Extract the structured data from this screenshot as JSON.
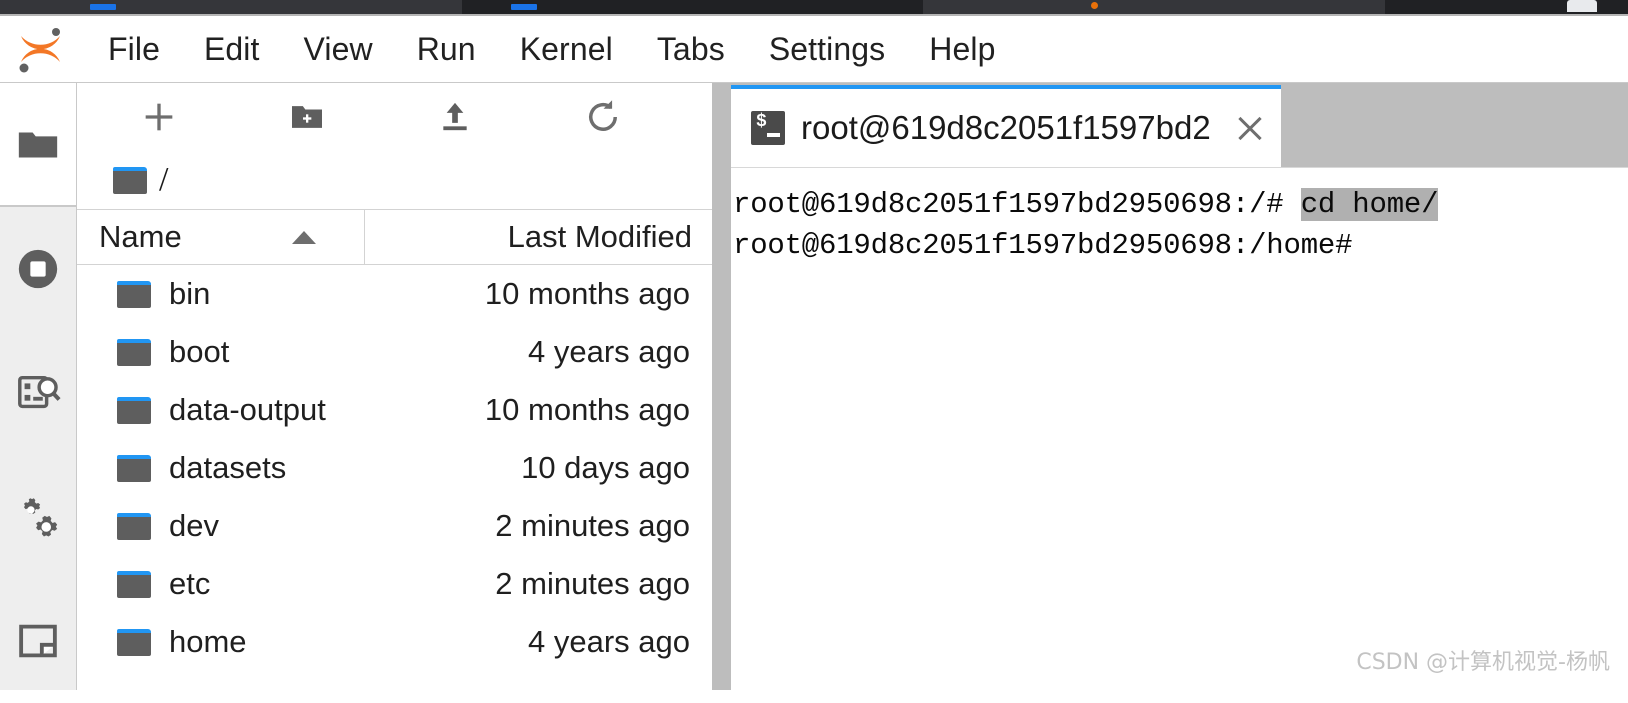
{
  "browser_chrome": {
    "present": true,
    "tab_accent_color": "#1a73e8",
    "tab_dot_color": "#e8710a",
    "bar_color": "#202124"
  },
  "app": {
    "name": "JupyterLab",
    "logo_name": "jupyter-logo",
    "logo_color": "#f37726"
  },
  "menubar": {
    "items": [
      {
        "label": "File",
        "name": "menu-file"
      },
      {
        "label": "Edit",
        "name": "menu-edit"
      },
      {
        "label": "View",
        "name": "menu-view"
      },
      {
        "label": "Run",
        "name": "menu-run"
      },
      {
        "label": "Kernel",
        "name": "menu-kernel"
      },
      {
        "label": "Tabs",
        "name": "menu-tabs"
      },
      {
        "label": "Settings",
        "name": "menu-settings"
      },
      {
        "label": "Help",
        "name": "menu-help"
      }
    ]
  },
  "activity_bar": {
    "items": [
      {
        "icon": "folder-icon",
        "label": "File Browser",
        "active": true
      },
      {
        "icon": "running-sessions-icon",
        "label": "Running Terminals and Kernels",
        "active": false
      },
      {
        "icon": "command-palette-icon",
        "label": "Commands",
        "active": false
      },
      {
        "icon": "extension-manager-icon",
        "label": "Extension Manager",
        "active": false
      },
      {
        "icon": "open-tabs-icon",
        "label": "Open Tabs",
        "active": false
      }
    ]
  },
  "file_browser": {
    "toolbar": [
      {
        "icon": "new-launcher-icon",
        "label": "New Launcher"
      },
      {
        "icon": "new-folder-icon",
        "label": "New Folder"
      },
      {
        "icon": "upload-icon",
        "label": "Upload Files"
      },
      {
        "icon": "refresh-icon",
        "label": "Refresh File List"
      }
    ],
    "breadcrumb": {
      "root_icon": "folder-icon",
      "path": "/"
    },
    "columns": {
      "name": "Name",
      "last_modified": "Last Modified",
      "sort_column": "Name",
      "sort_direction": "ascending"
    },
    "rows": [
      {
        "icon": "folder-icon",
        "name": "bin",
        "last_modified": "10 months ago"
      },
      {
        "icon": "folder-icon",
        "name": "boot",
        "last_modified": "4 years ago"
      },
      {
        "icon": "folder-icon",
        "name": "data-output",
        "last_modified": "10 months ago"
      },
      {
        "icon": "folder-icon",
        "name": "datasets",
        "last_modified": "10 days ago"
      },
      {
        "icon": "folder-icon",
        "name": "dev",
        "last_modified": "2 minutes ago"
      },
      {
        "icon": "folder-icon",
        "name": "etc",
        "last_modified": "2 minutes ago"
      },
      {
        "icon": "folder-icon",
        "name": "home",
        "last_modified": "4 years ago"
      }
    ]
  },
  "dock": {
    "tabs": [
      {
        "icon": "terminal-icon",
        "title": "root@619d8c2051f1597bd2",
        "active": true,
        "close_label": "×",
        "accent_color": "#2196f3"
      }
    ]
  },
  "terminal": {
    "lines": [
      {
        "prompt": "root@619d8c2051f1597bd2950698:/# ",
        "command": "cd home/",
        "selected": true
      },
      {
        "prompt": "root@619d8c2051f1597bd2950698:/home#",
        "command": "",
        "selected": false
      }
    ],
    "selection_color": "#b0b0b0"
  },
  "watermark": {
    "text": "CSDN @计算机视觉-杨帆"
  }
}
